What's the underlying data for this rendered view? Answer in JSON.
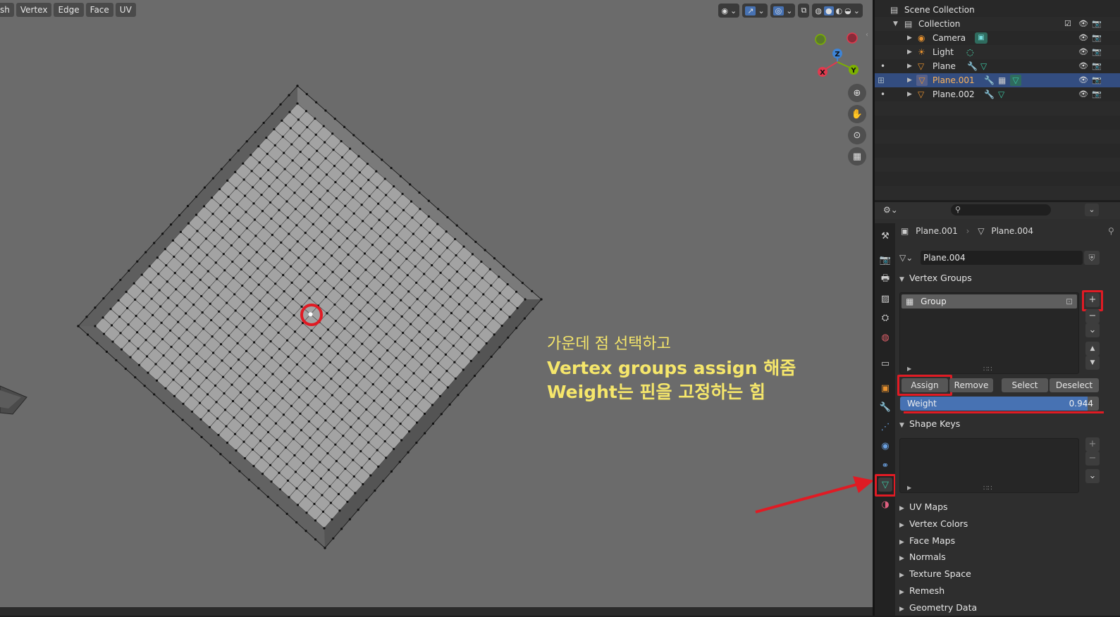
{
  "viewport": {
    "menu": [
      "sh",
      "Vertex",
      "Edge",
      "Face",
      "UV"
    ],
    "gizmo": {
      "z": "Z",
      "y": "Y",
      "x": "X"
    },
    "annotation": {
      "line1": "가운데 점 선택하고",
      "line2": "Vertex groups  assign 해줌",
      "line3": "Weight는 핀을 고정하는 힘"
    }
  },
  "outliner": {
    "scene_collection": "Scene Collection",
    "collection": "Collection",
    "items": [
      {
        "name": "Camera"
      },
      {
        "name": "Light"
      },
      {
        "name": "Plane"
      },
      {
        "name": "Plane.001"
      },
      {
        "name": "Plane.002"
      }
    ]
  },
  "properties": {
    "breadcrumb": {
      "object": "Plane.001",
      "mesh": "Plane.004"
    },
    "mesh_name": "Plane.004",
    "vertex_groups": {
      "title": "Vertex Groups",
      "items": [
        "Group"
      ],
      "buttons": {
        "assign": "Assign",
        "remove": "Remove",
        "select": "Select",
        "deselect": "Deselect"
      },
      "weight_label": "Weight",
      "weight_value": "0.944",
      "weight": 0.944
    },
    "shape_keys": {
      "title": "Shape Keys"
    },
    "panels": [
      "UV Maps",
      "Vertex Colors",
      "Face Maps",
      "Normals",
      "Texture Space",
      "Remesh",
      "Geometry Data"
    ]
  },
  "colors": {
    "accent_blue": "#4772b3",
    "selection_row": "#334d80",
    "annotation": "#f5e66b",
    "highlight_red": "#e01b24",
    "mesh_face": "#a3a3a3"
  }
}
